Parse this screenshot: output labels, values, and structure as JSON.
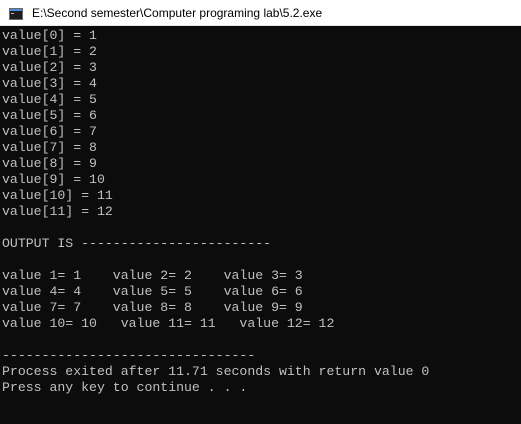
{
  "window": {
    "title": "E:\\Second semester\\Computer programing lab\\5.2.exe",
    "icon": "console-app-icon"
  },
  "console": {
    "lines": [
      "value[0] = 1",
      "value[1] = 2",
      "value[2] = 3",
      "value[3] = 4",
      "value[4] = 5",
      "value[5] = 6",
      "value[6] = 7",
      "value[7] = 8",
      "value[8] = 9",
      "value[9] = 10",
      "value[10] = 11",
      "value[11] = 12",
      "",
      "OUTPUT IS ------------------------",
      "",
      "value 1= 1    value 2= 2    value 3= 3",
      "value 4= 4    value 5= 5    value 6= 6",
      "value 7= 7    value 8= 8    value 9= 9",
      "value 10= 10   value 11= 11   value 12= 12",
      "",
      "--------------------------------",
      "Process exited after 11.71 seconds with return value 0",
      "Press any key to continue . . ."
    ]
  },
  "colors": {
    "background": "#0c0c0c",
    "text": "#c0c0c0",
    "titlebar": "#ffffff"
  }
}
